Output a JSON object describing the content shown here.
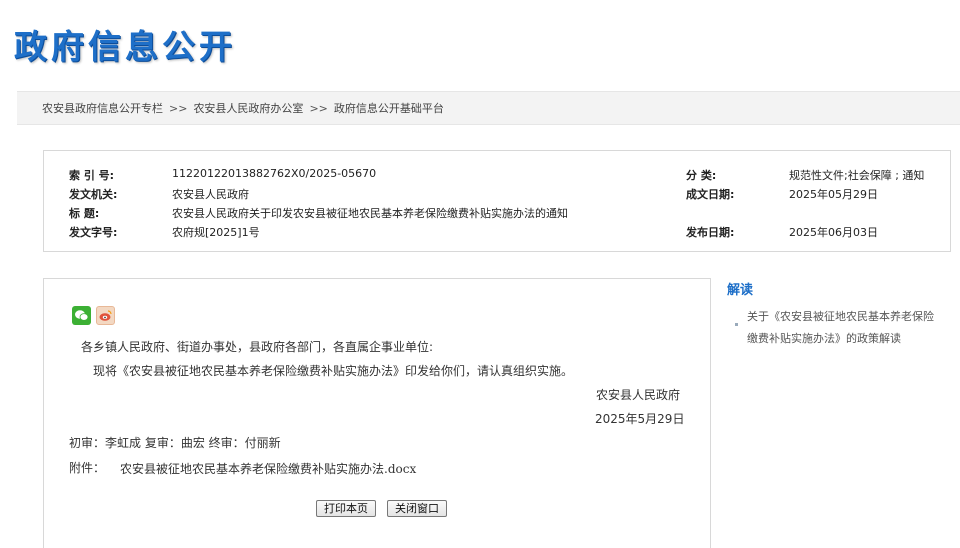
{
  "header": {
    "logo_text": "政府信息公开"
  },
  "breadcrumb": {
    "items": [
      "农安县政府信息公开专栏",
      "农安县人民政府办公室",
      "政府信息公开基础平台"
    ],
    "sep1": ">>",
    "sep2": ">>"
  },
  "meta": {
    "index_label": "索 引 号:",
    "index_value": "11220122013882762X0/2025-05670",
    "category_label": "分   类:",
    "category_value": "规范性文件;社会保障 ; 通知",
    "issuer_label": "发文机关:",
    "issuer_value": "农安县人民政府",
    "written_label": "成文日期:",
    "written_value": "2025年05月29日",
    "title_label": "标    题:",
    "title_value": "农安县人民政府关于印发农安县被征地农民基本养老保险缴费补贴实施办法的通知",
    "docno_label": "发文字号:",
    "docno_value": "农府规[2025]1号",
    "published_label": "发布日期:",
    "published_value": "2025年06月03日"
  },
  "content": {
    "salutation": "各乡镇人民政府、街道办事处，县政府各部门，各直属企事业单位:",
    "body": "现将《农安县被征地农民基本养老保险缴费补贴实施办法》印发给你们，请认真组织实施。",
    "signer": "农安县人民政府",
    "date": "2025年5月29日",
    "review": "初审：李虹成  复审：曲宏  终审：付丽新",
    "attachment_label": "附件：",
    "attachment_file": "农安县被征地农民基本养老保险缴费补贴实施办法.docx",
    "print_button": "打印本页",
    "close_button": "关闭窗口"
  },
  "sidebar": {
    "title": "解读",
    "item_line1": "关于《农安县被征地农民基本养老保险",
    "item_line2": "缴费补贴实施办法》的政策解读"
  },
  "colors": {
    "brand": "#1e6fc8",
    "wechat": "#3cb034"
  },
  "icons": [
    "wechat-icon",
    "weibo-icon"
  ]
}
